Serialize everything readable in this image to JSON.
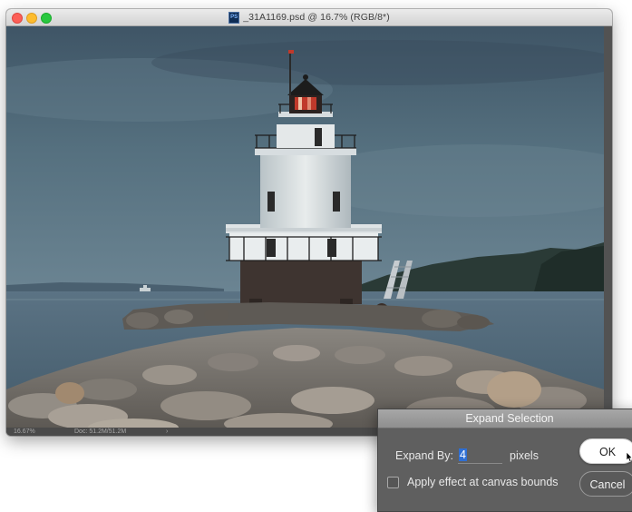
{
  "document_window": {
    "title": "_31A1169.psd @ 16.7% (RGB/8*)",
    "file_icon_label": "PS"
  },
  "status_bar": {
    "zoom": "16.67%",
    "doc_size": "Doc: 51.2M/51.2M",
    "arrow": "›"
  },
  "dialog": {
    "title": "Expand Selection",
    "expand_by_label": "Expand By:",
    "expand_by_value": "4",
    "units": "pixels",
    "checkbox_label": "Apply effect at canvas bounds",
    "checkbox_checked": false,
    "ok_label": "OK",
    "cancel_label": "Cancel"
  },
  "colors": {
    "sky": "#4f6a7c",
    "water": "#50687a",
    "dialog_bg": "#5f5f5f",
    "selection": "#2f6fd3"
  }
}
